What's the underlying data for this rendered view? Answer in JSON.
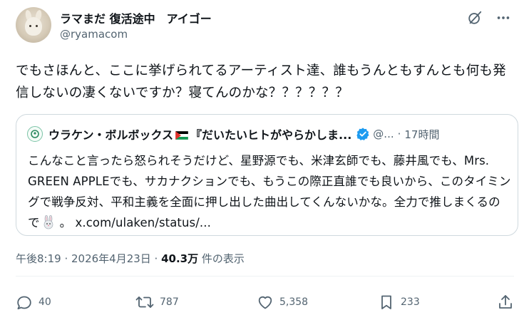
{
  "author": {
    "display_name": "ラマまだ 復活途中　アイゴー",
    "handle": "@ryamacom"
  },
  "tweet": {
    "text": "でもさほんと、ここに挙げられてるアーティスト達、誰もうんともすんとも何も発信しないの凄くないですか？寝てんのかな？？？？？？"
  },
  "quote": {
    "name_before_flag": "ウラケン・ボルボックス",
    "name_after_flag": "『だいたいヒトがやらかしま...",
    "handle": "@...",
    "separator": "·",
    "time": "17時間",
    "body": "こんなこと言ったら怒られそうだけど、星野源でも、米津玄師でも、藤井風でも、Mrs. GREEN APPLEでも、サカナクションでも、もうこの際正直誰でも良いから、このタイミングで戦争反対、平和主義を全面に押し出した曲出してくんないかな。全力で推しまくるので",
    "link": "。 x.com/ulaken/status/..."
  },
  "meta": {
    "time": "午後8:19 · 2026年4月23日 · ",
    "views": "40.3万",
    "views_label": " 件の表示"
  },
  "actions": {
    "replies": "40",
    "retweets": "787",
    "likes": "5,358",
    "bookmarks": "233"
  },
  "colors": {
    "text": "#0f1419",
    "secondary": "#536471",
    "border": "#cfd9de",
    "verified": "#1d9bf0"
  },
  "icons": [
    "grok-icon",
    "more-icon",
    "verified-icon",
    "palestine-flag-icon",
    "rabbit-emoji-icon",
    "reply-icon",
    "retweet-icon",
    "like-icon",
    "bookmark-icon",
    "share-icon"
  ]
}
